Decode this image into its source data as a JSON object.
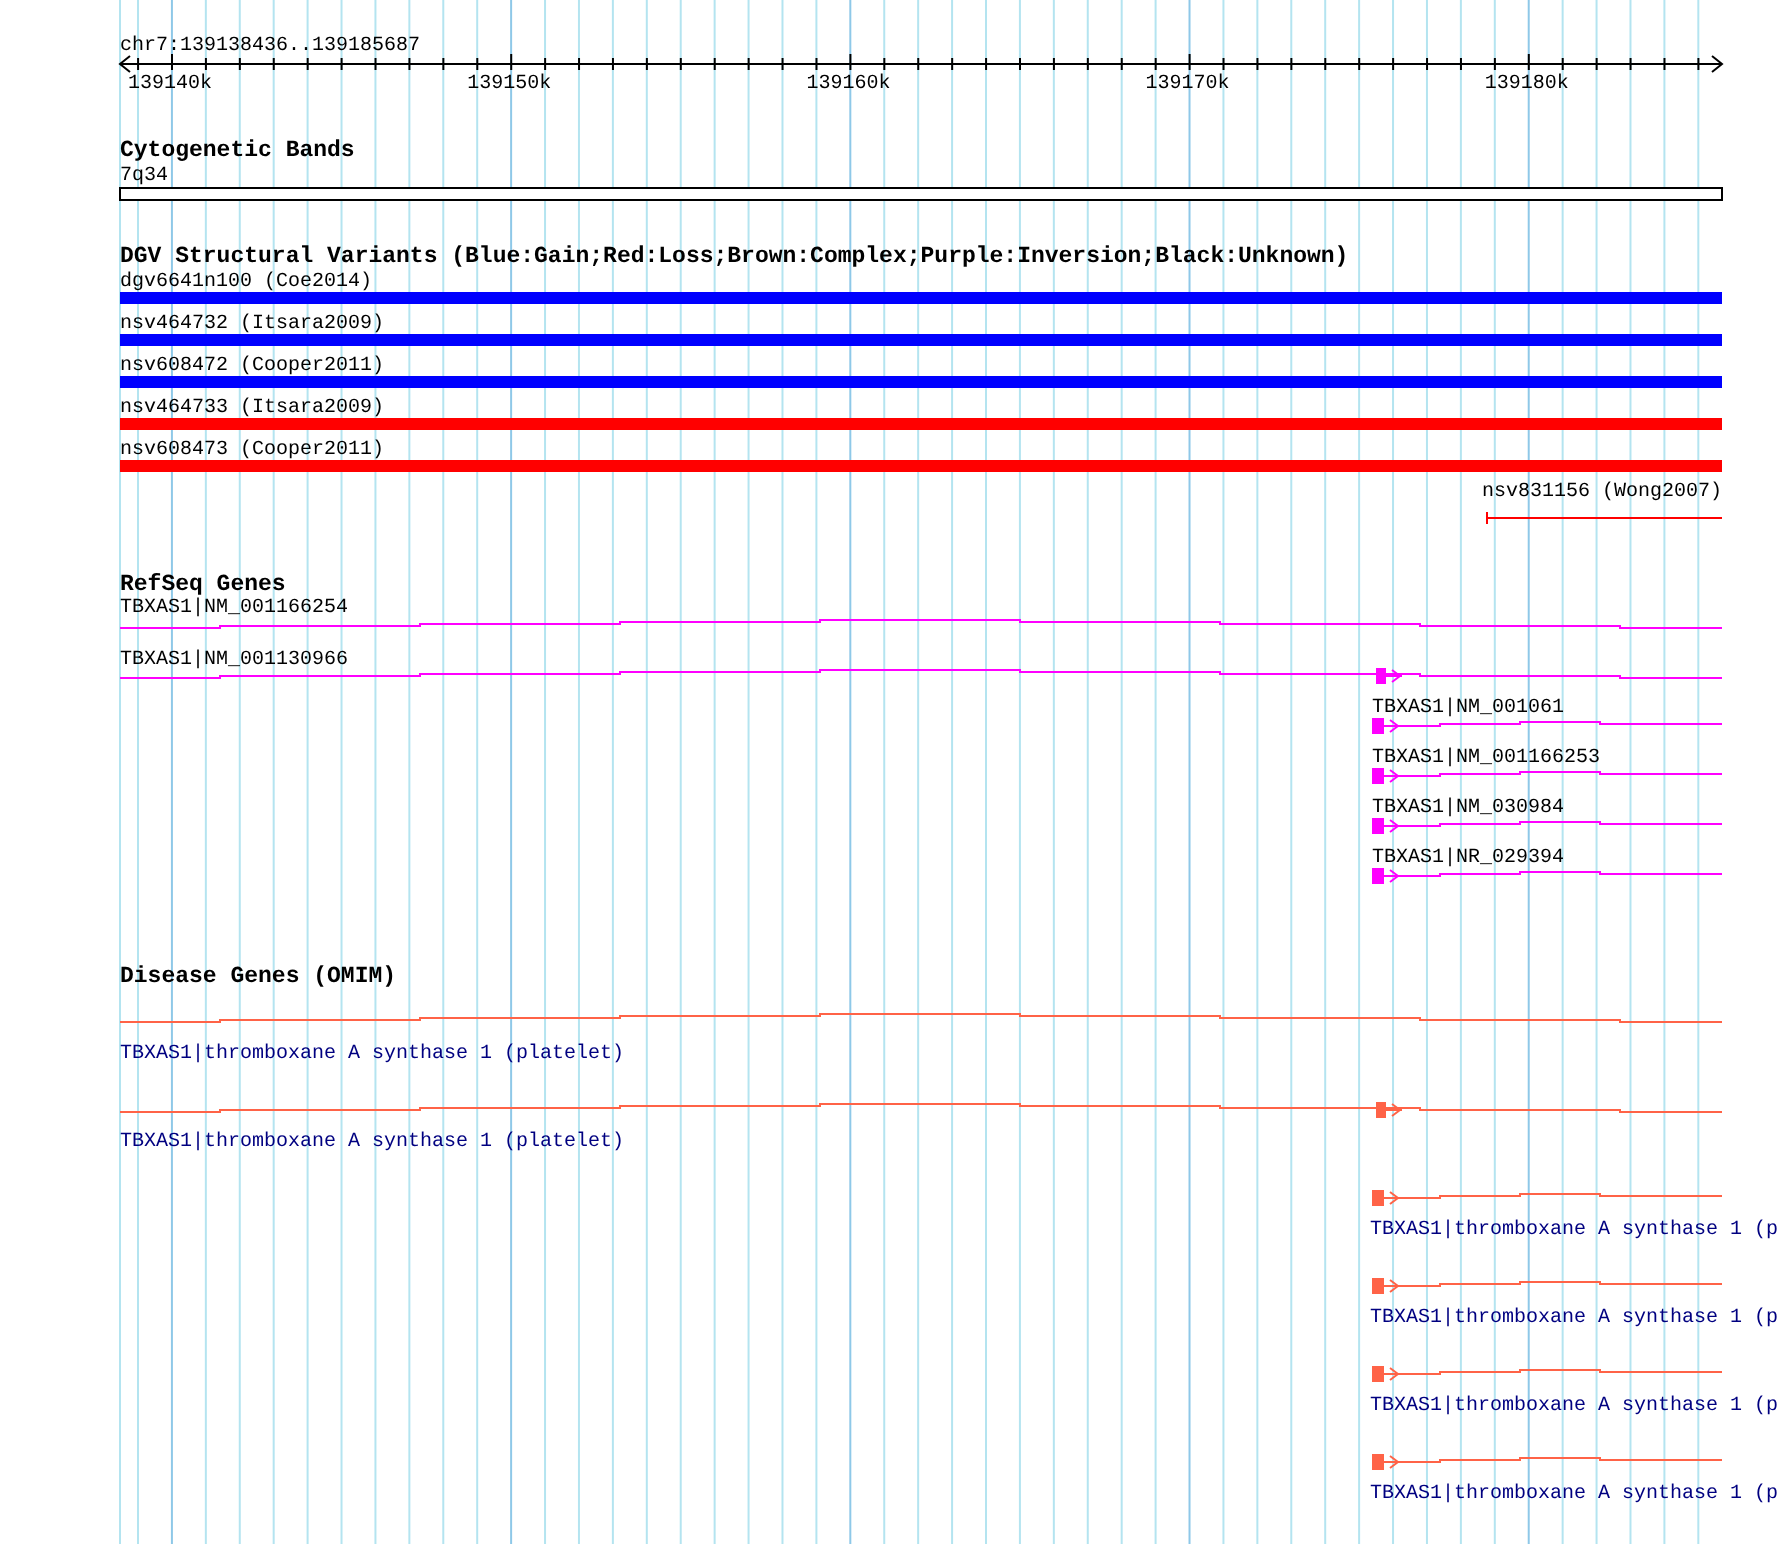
{
  "locus": "chr7:139138436..139185687",
  "ruler": {
    "ticks": [
      "139140k",
      "139150k",
      "139160k",
      "139170k",
      "139180k"
    ]
  },
  "tracks": [
    {
      "title": "Cytogenetic Bands",
      "kind": "bands",
      "features": [
        {
          "label": "7q34"
        }
      ]
    },
    {
      "title": "DGV Structural Variants (Blue:Gain;Red:Loss;Brown:Complex;Purple:Inversion;Black:Unknown)",
      "kind": "variants",
      "features": [
        {
          "label": "dgv6641n100 (Coe2014)",
          "color": "#0000ff",
          "kind": "full"
        },
        {
          "label": "nsv464732 (Itsara2009)",
          "color": "#0000ff",
          "kind": "full"
        },
        {
          "label": "nsv608472 (Cooper2011)",
          "color": "#0000ff",
          "kind": "full"
        },
        {
          "label": "nsv464733 (Itsara2009)",
          "color": "#ff0000",
          "kind": "full"
        },
        {
          "label": "nsv608473 (Cooper2011)",
          "color": "#ff0000",
          "kind": "full"
        },
        {
          "label": "nsv831156 (Wong2007)",
          "color": "#ff0000",
          "kind": "partial"
        }
      ]
    },
    {
      "title": "RefSeq Genes",
      "kind": "refseq",
      "features": [
        {
          "label": "TBXAS1|NM_001166254",
          "kind": "long"
        },
        {
          "label": "TBXAS1|NM_001130966",
          "kind": "long_start"
        },
        {
          "label": "TBXAS1|NM_001061",
          "kind": "short"
        },
        {
          "label": "TBXAS1|NM_001166253",
          "kind": "short"
        },
        {
          "label": "TBXAS1|NM_030984",
          "kind": "short"
        },
        {
          "label": "TBXAS1|NR_029394",
          "kind": "short"
        }
      ]
    },
    {
      "title": "Disease Genes (OMIM)",
      "kind": "omim",
      "features": [
        {
          "label": "TBXAS1|thromboxane A synthase 1 (platelet)",
          "kind": "long"
        },
        {
          "label": "TBXAS1|thromboxane A synthase 1 (platelet)",
          "kind": "long_start"
        },
        {
          "label": "TBXAS1|thromboxane A synthase 1 (p",
          "kind": "short"
        },
        {
          "label": "TBXAS1|thromboxane A synthase 1 (p",
          "kind": "short"
        },
        {
          "label": "TBXAS1|thromboxane A synthase 1 (p",
          "kind": "short"
        },
        {
          "label": "TBXAS1|thromboxane A synthase 1 (p",
          "kind": "short"
        }
      ]
    }
  ]
}
